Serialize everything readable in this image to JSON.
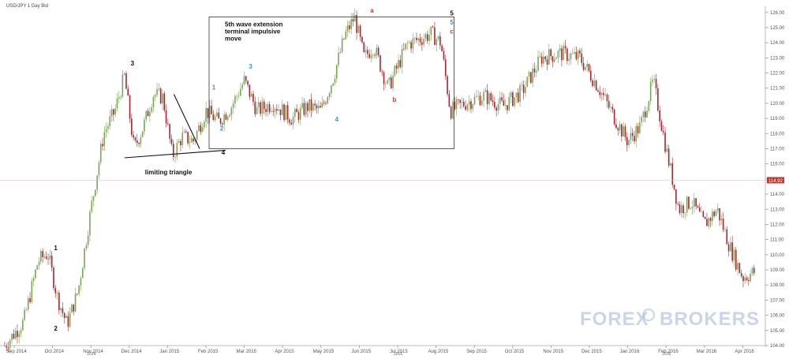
{
  "chart_data": {
    "type": "candlestick",
    "title": "USD/JPY  1 Day Bid",
    "x_ticks": [
      "Sep 2014",
      "Oct 2014",
      "Nov 2014",
      "Dec 2014",
      "Jan 2015",
      "Feb 2015",
      "Mar 2015",
      "Apr 2015",
      "May 2015",
      "Jun 2015",
      "Jul 2015",
      "Aug 2015",
      "Sep 2015",
      "Oct 2015",
      "Nov 2015",
      "Dec 2015",
      "Jan 2016",
      "Feb 2016",
      "Mar 2016",
      "Apr 2016"
    ],
    "year_ticks": [
      "2014",
      "2015",
      "2016"
    ],
    "y_ticks": [
      "104.00",
      "105.00",
      "106.00",
      "107.00",
      "108.00",
      "109.00",
      "110.00",
      "111.00",
      "112.00",
      "113.00",
      "114.00",
      "115.00",
      "116.00",
      "117.00",
      "118.00",
      "119.00",
      "120.00",
      "121.00",
      "122.00",
      "123.00",
      "124.00",
      "125.00",
      "126.00"
    ],
    "ylim": [
      104,
      126.3
    ],
    "current_price": "114.92",
    "price_path": [
      [
        "Sep 2014",
        104.0
      ],
      [
        "Sep 2014",
        105.6
      ],
      [
        "Oct 2014",
        109.6
      ],
      [
        "Oct 2014",
        110.1
      ],
      [
        "Oct 2014",
        107.2
      ],
      [
        "Oct 2014",
        105.4
      ],
      [
        "Nov 2014",
        107.6
      ],
      [
        "Nov 2014",
        113.0
      ],
      [
        "Nov 2014",
        118.0
      ],
      [
        "Dec 2014",
        119.5
      ],
      [
        "Dec 2014",
        121.8
      ],
      [
        "Dec 2014",
        117.0
      ],
      [
        "Dec 2014",
        118.5
      ],
      [
        "Jan 2015",
        120.6
      ],
      [
        "Jan 2015",
        120.4
      ],
      [
        "Jan 2015",
        116.5
      ],
      [
        "Jan 2015",
        117.8
      ],
      [
        "Feb 2015",
        117.5
      ],
      [
        "Feb 2015",
        119.5
      ],
      [
        "Feb 2015",
        118.8
      ],
      [
        "Mar 2015",
        119.8
      ],
      [
        "Mar 2015",
        121.5
      ],
      [
        "Mar 2015",
        119.5
      ],
      [
        "Apr 2015",
        120.0
      ],
      [
        "Apr 2015",
        119.0
      ],
      [
        "May 2015",
        119.8
      ],
      [
        "May 2015",
        119.5
      ],
      [
        "May 2015",
        121.8
      ],
      [
        "Jun 2015",
        124.5
      ],
      [
        "Jun 2015",
        125.7
      ],
      [
        "Jun 2015",
        123.0
      ],
      [
        "Jun 2015",
        123.8
      ],
      [
        "Jul 2015",
        121.0
      ],
      [
        "Jul 2015",
        123.9
      ],
      [
        "Aug 2015",
        124.3
      ],
      [
        "Aug 2015",
        124.6
      ],
      [
        "Aug 2015",
        124.0
      ],
      [
        "Aug 2015",
        119.5
      ],
      [
        "Sep 2015",
        120.0
      ],
      [
        "Sep 2015",
        120.5
      ],
      [
        "Oct 2015",
        119.8
      ],
      [
        "Oct 2015",
        120.8
      ],
      [
        "Nov 2015",
        123.0
      ],
      [
        "Nov 2015",
        123.3
      ],
      [
        "Dec 2015",
        123.0
      ],
      [
        "Dec 2015",
        121.0
      ],
      [
        "Jan 2016",
        119.0
      ],
      [
        "Jan 2016",
        117.5
      ],
      [
        "Jan 2016",
        118.5
      ],
      [
        "Feb 2016",
        121.5
      ],
      [
        "Feb 2016",
        117.0
      ],
      [
        "Feb 2016",
        113.0
      ],
      [
        "Mar 2016",
        113.5
      ],
      [
        "Mar 2016",
        112.0
      ],
      [
        "Mar 2016",
        113.0
      ],
      [
        "Apr 2016",
        110.5
      ],
      [
        "Apr 2016",
        108.5
      ],
      [
        "Apr 2016",
        108.9
      ]
    ],
    "wave_labels": [
      {
        "text": "1",
        "color": "#111111",
        "date": "Oct 2014",
        "price": 110.3
      },
      {
        "text": "2",
        "color": "#111111",
        "date": "Oct 2014",
        "price": 105.0
      },
      {
        "text": "3",
        "color": "#111111",
        "date": "Dec 2014",
        "price": 122.5
      },
      {
        "text": "4",
        "color": "#111111",
        "date": "Feb 2015",
        "price": 116.6
      },
      {
        "text": "1",
        "color": "#3a8fd0",
        "date": "Feb 2015",
        "price": 120.9
      },
      {
        "text": "2",
        "color": "#3a8fd0",
        "date": "Feb 2015",
        "price": 118.2
      },
      {
        "text": "3",
        "color": "#3a8fd0",
        "date": "Mar 2015",
        "price": 122.3
      },
      {
        "text": "4",
        "color": "#3a8fd0",
        "date": "May 2015",
        "price": 118.8
      },
      {
        "text": "a",
        "color": "#c0392b",
        "date": "Jun 2015",
        "price": 126.0
      },
      {
        "text": "b",
        "color": "#c0392b",
        "date": "Jul 2015",
        "price": 120.1
      },
      {
        "text": "5",
        "color": "#111111",
        "date": "Aug 2015",
        "price": 125.8
      },
      {
        "text": "5",
        "color": "#3a8fd0",
        "date": "Aug 2015",
        "price": 125.2
      },
      {
        "text": "c",
        "color": "#c0392b",
        "date": "Aug 2015",
        "price": 124.6
      }
    ],
    "annotations": [
      "5th wave extension",
      "terminal impulsive",
      "move",
      "limiting triangle"
    ],
    "triangle_lines": [
      {
        "from": [
          "Jan 2015",
          120.6
        ],
        "to": [
          "Feb 2015",
          117.0
        ]
      },
      {
        "from": [
          "Dec 2014",
          116.4
        ],
        "to": [
          "Feb 2015",
          116.9
        ]
      }
    ],
    "highlight_box": {
      "from": [
        "Feb 2015",
        117.0
      ],
      "to": [
        "Aug 2015",
        125.7
      ]
    },
    "up_color": "#7aa556",
    "down_color": "#a32531",
    "grid": false
  },
  "watermark": "FOREX BROKERS",
  "colors": {
    "accent_red": "#c0392b",
    "price_tag": "#c0392b",
    "wave_blue": "#3a8fd0",
    "watermark_blue": "#8aa3cf"
  }
}
